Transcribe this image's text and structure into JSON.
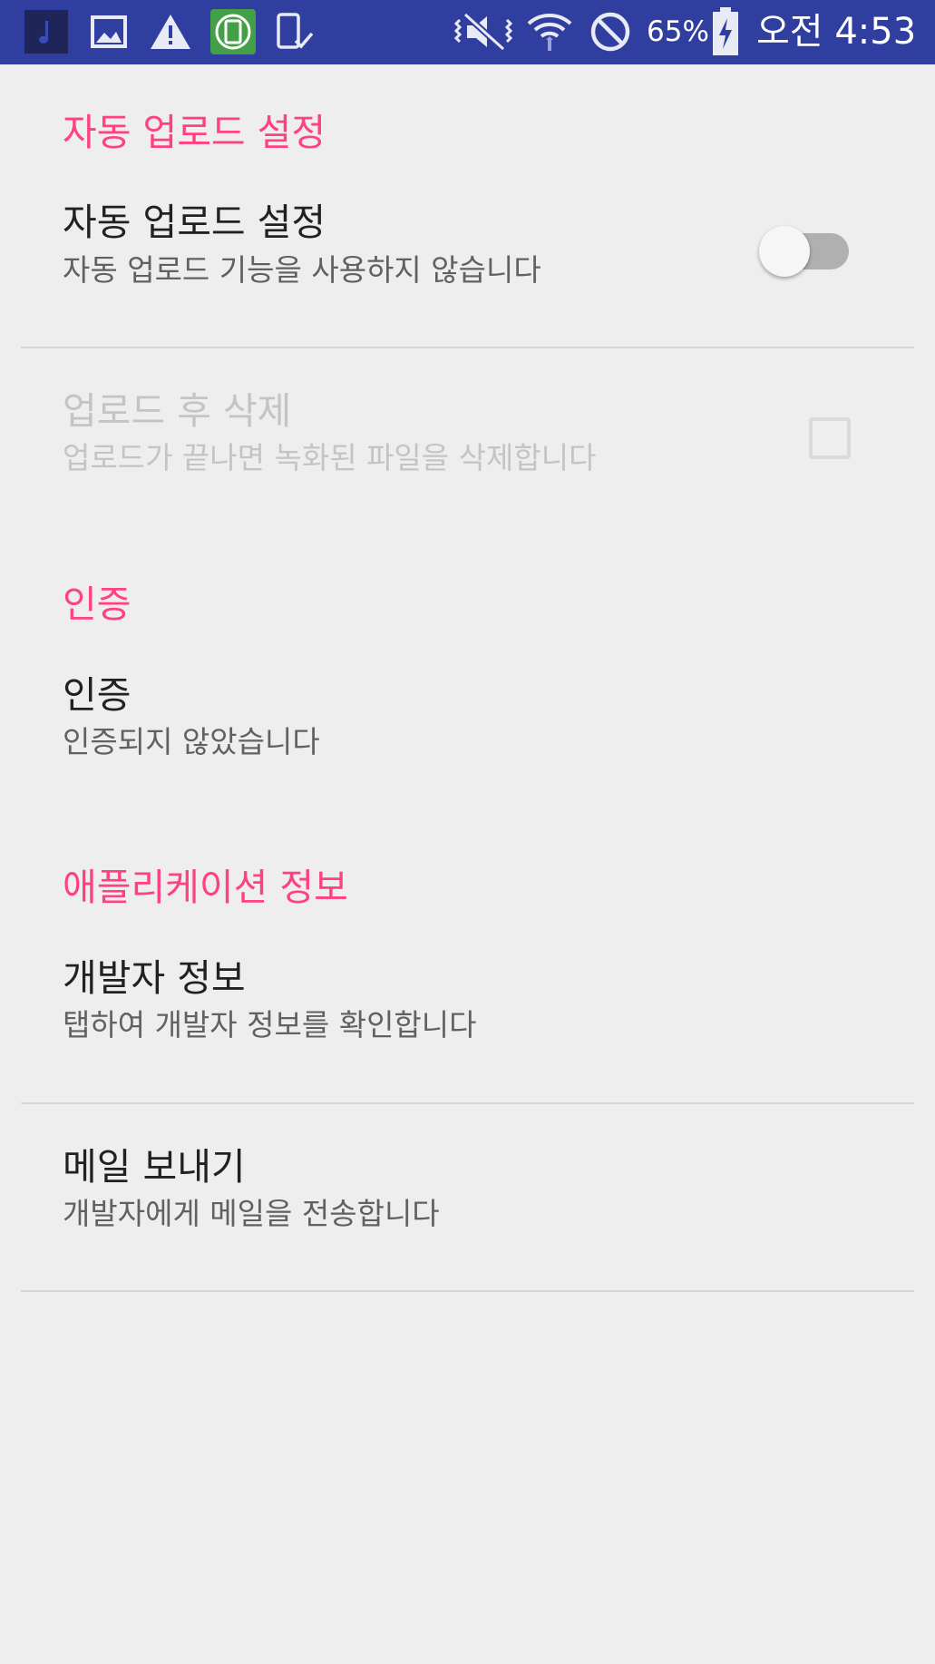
{
  "status_bar": {
    "battery_percent": "65%",
    "time": "오전 4:53",
    "icons": [
      "music-note-icon",
      "image-icon",
      "warning-icon",
      "screen-rotation-icon",
      "phone-check-icon",
      "vibrate-mute-icon",
      "wifi-icon",
      "do-not-disturb-icon",
      "battery-charging-icon"
    ],
    "background_color": "#303f9f"
  },
  "sections": {
    "auto_upload": {
      "header": "자동 업로드 설정",
      "auto_upload_pref": {
        "title": "자동 업로드 설정",
        "summary": "자동 업로드 기능을 사용하지 않습니다",
        "switch_on": false
      },
      "delete_after_upload_pref": {
        "title": "업로드 후 삭제",
        "summary": "업로드가 끝나면 녹화된 파일을 삭제합니다",
        "checked": false,
        "enabled": false
      }
    },
    "auth": {
      "header": "인증",
      "auth_pref": {
        "title": "인증",
        "summary": "인증되지 않았습니다"
      }
    },
    "app_info": {
      "header": "애플리케이션 정보",
      "developer_info_pref": {
        "title": "개발자 정보",
        "summary": "탭하여 개발자 정보를 확인합니다"
      },
      "send_mail_pref": {
        "title": "메일 보내기",
        "summary": "개발자에게 메일을 전송합니다"
      }
    }
  },
  "accent_color": "#ff4081"
}
